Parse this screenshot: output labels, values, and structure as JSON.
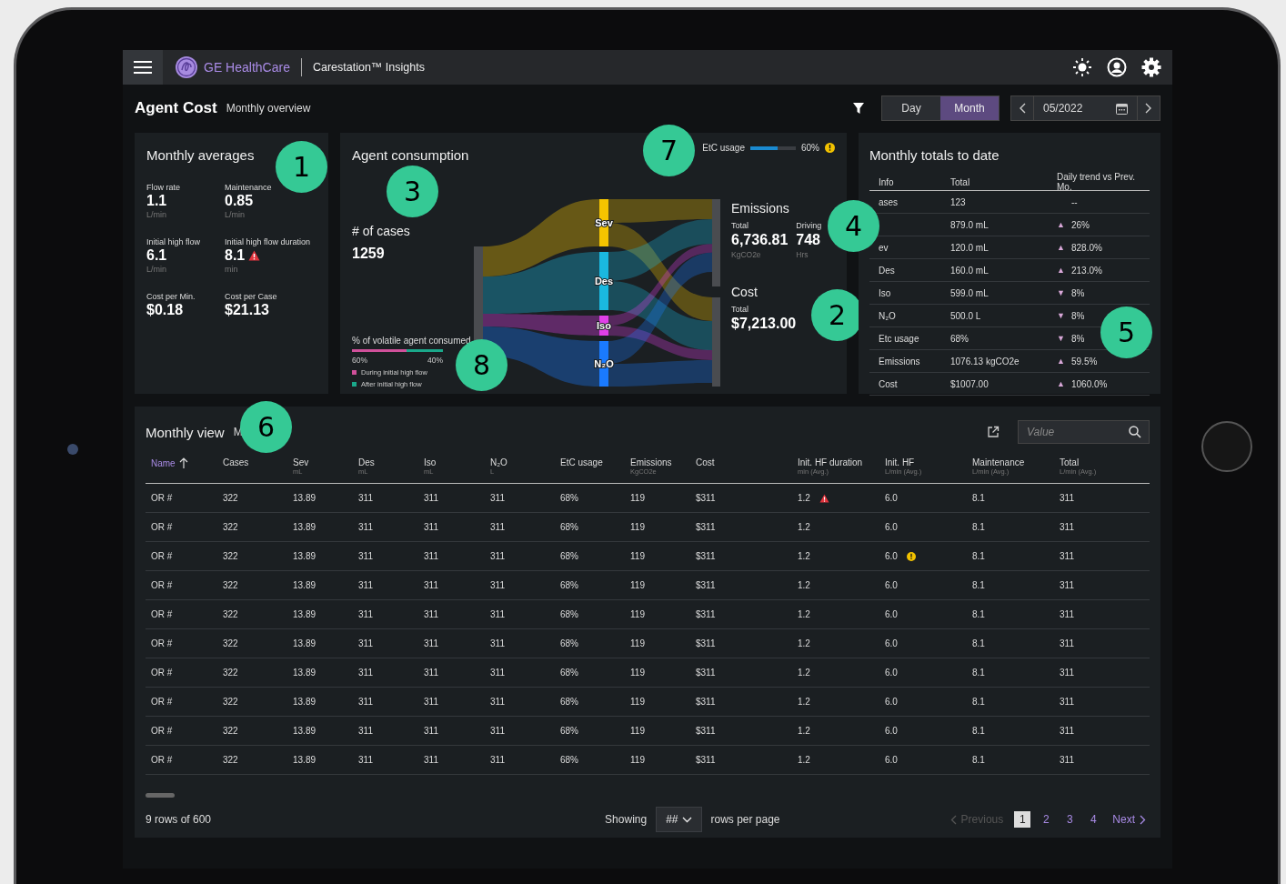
{
  "app": {
    "brand": "GE HealthCare",
    "product": "Carestation™ Insights"
  },
  "page": {
    "title": "Agent Cost",
    "subtitle": "Monthly overview"
  },
  "period": {
    "options": [
      {
        "label": "Day",
        "selected": false
      },
      {
        "label": "Month",
        "selected": true
      }
    ],
    "date": "05/2022"
  },
  "monthly_averages": {
    "title": "Monthly averages",
    "callout": "1",
    "stats": [
      {
        "label": "Flow rate",
        "value": "1.1",
        "unit": "L/min"
      },
      {
        "label": "Maintenance",
        "value": "0.85",
        "unit": "L/min"
      },
      {
        "label": "Initial high flow",
        "value": "6.1",
        "unit": "L/min"
      },
      {
        "label": "Initial high flow duration",
        "value": "8.1",
        "unit": "min",
        "error": true
      },
      {
        "label": "Cost per Min.",
        "value": "$0.18"
      },
      {
        "label": "Cost per Case",
        "value": "$21.13"
      }
    ]
  },
  "agent_consumption": {
    "title": "Agent consumption",
    "callouts": [
      "3",
      "7",
      "8",
      "2"
    ],
    "etc_usage": {
      "label": "EtC usage",
      "level": 0.6,
      "reading": "60%",
      "warning": true
    },
    "cases": {
      "label": "# of cases",
      "value": "1259"
    },
    "volatile": {
      "label": "% of volatile agent consumed",
      "level": 0.6,
      "left_reading": "60%",
      "right_reading": "40%",
      "legend": [
        {
          "label": "During initial high flow",
          "color": "#d0509a"
        },
        {
          "label": "After initial high flow",
          "color": "#1aa88a"
        }
      ]
    },
    "sankey_nodes": [
      {
        "label": "Sev",
        "color": "#f5c400"
      },
      {
        "label": "Des",
        "color": "#1ab8e0"
      },
      {
        "label": "Iso",
        "color": "#e040e8"
      },
      {
        "label": "N₂O",
        "color": "#1a7aff"
      }
    ],
    "emissions": {
      "title": "Emissions",
      "stats": [
        {
          "label": "Total",
          "value": "6,736.81",
          "unit": "KgCO2e"
        },
        {
          "label": "Driving",
          "value": "748",
          "unit": "Hrs"
        }
      ]
    },
    "cost": {
      "title": "Cost",
      "stats": [
        {
          "label": "Total",
          "value": "$7,213.00"
        }
      ]
    }
  },
  "monthly_totals": {
    "title": "Monthly totals to date",
    "callouts": [
      "4",
      "5"
    ],
    "columns": [
      "Info",
      "Total",
      "Daily trend vs Prev. Mo."
    ],
    "rows": [
      {
        "info": "ases",
        "total": "123",
        "change": "--"
      },
      {
        "total": "879.0 mL",
        "trend_icon": "▲",
        "change": "26%"
      },
      {
        "info": "ev",
        "total": "120.0 mL",
        "trend_icon": "▲",
        "change": "828.0%"
      },
      {
        "info": "Des",
        "total": "160.0 mL",
        "trend_icon": "▲",
        "change": "213.0%"
      },
      {
        "info": "Iso",
        "total": "599.0 mL",
        "trend_icon": "▼",
        "change": "8%"
      },
      {
        "info": "N₂O",
        "total": "500.0 L",
        "trend_icon": "▼",
        "change": "8%"
      },
      {
        "info": "Etc usage",
        "total": "68%",
        "trend_icon": "▼",
        "change": "8%"
      },
      {
        "info": "Emissions",
        "total": "1076.13 kgCO2e",
        "trend_icon": "▲",
        "change": "59.5%"
      },
      {
        "info": "Cost",
        "total": "$1007.00",
        "trend_icon": "▲",
        "change": "1060.0%"
      }
    ]
  },
  "monthly_view": {
    "title": "Monthly view",
    "subtitle": "M",
    "callout": "6",
    "search": {
      "placeholder": "Value"
    },
    "columns": [
      {
        "label": "Name",
        "sorted": true
      },
      {
        "label": "Cases",
        "sorted": false
      },
      {
        "label": "Sev",
        "unit": "mL",
        "sorted": false
      },
      {
        "label": "Des",
        "unit": "mL",
        "sorted": false
      },
      {
        "label": "Iso",
        "unit": "mL",
        "sorted": false
      },
      {
        "label": "N₂O",
        "unit": "L",
        "sorted": false
      },
      {
        "label": "EtC usage",
        "sorted": false
      },
      {
        "label": "Emissions",
        "unit": "KgCO2e",
        "sorted": false
      },
      {
        "label": "Cost",
        "sorted": false
      },
      {
        "label": "Init. HF duration",
        "unit": "min (Avg.)",
        "sorted": false
      },
      {
        "label": "Init. HF",
        "unit": "L/min (Avg.)",
        "sorted": false
      },
      {
        "label": "Maintenance",
        "unit": "L/min (Avg.)",
        "sorted": false
      },
      {
        "label": "Total",
        "unit": "L/min (Avg.)",
        "sorted": false
      }
    ],
    "rows": [
      {
        "cells": [
          "OR #",
          "322",
          "13.89",
          "311",
          "311",
          "311",
          "68%",
          "119",
          "$311",
          {
            "text": "1.2",
            "error": true
          },
          "6.0",
          "8.1",
          "311"
        ]
      },
      {
        "cells": [
          "OR #",
          "322",
          "13.89",
          "311",
          "311",
          "311",
          "68%",
          "119",
          "$311",
          "1.2",
          "6.0",
          "8.1",
          "311"
        ]
      },
      {
        "cells": [
          "OR #",
          "322",
          "13.89",
          "311",
          "311",
          "311",
          "68%",
          "119",
          "$311",
          "1.2",
          {
            "text": "6.0",
            "warning": true
          },
          "8.1",
          "311"
        ]
      },
      {
        "cells": [
          "OR #",
          "322",
          "13.89",
          "311",
          "311",
          "311",
          "68%",
          "119",
          "$311",
          "1.2",
          "6.0",
          "8.1",
          "311"
        ]
      },
      {
        "cells": [
          "OR #",
          "322",
          "13.89",
          "311",
          "311",
          "311",
          "68%",
          "119",
          "$311",
          "1.2",
          "6.0",
          "8.1",
          "311"
        ]
      },
      {
        "cells": [
          "OR #",
          "322",
          "13.89",
          "311",
          "311",
          "311",
          "68%",
          "119",
          "$311",
          "1.2",
          "6.0",
          "8.1",
          "311"
        ]
      },
      {
        "cells": [
          "OR #",
          "322",
          "13.89",
          "311",
          "311",
          "311",
          "68%",
          "119",
          "$311",
          "1.2",
          "6.0",
          "8.1",
          "311"
        ]
      },
      {
        "cells": [
          "OR #",
          "322",
          "13.89",
          "311",
          "311",
          "311",
          "68%",
          "119",
          "$311",
          "1.2",
          "6.0",
          "8.1",
          "311"
        ]
      },
      {
        "cells": [
          "OR #",
          "322",
          "13.89",
          "311",
          "311",
          "311",
          "68%",
          "119",
          "$311",
          "1.2",
          "6.0",
          "8.1",
          "311"
        ]
      },
      {
        "cells": [
          "OR #",
          "322",
          "13.89",
          "311",
          "311",
          "311",
          "68%",
          "119",
          "$311",
          "1.2",
          "6.0",
          "8.1",
          "311"
        ]
      }
    ],
    "footer": {
      "count": "9 rows of 600",
      "showing": "Showing",
      "page_size": "##",
      "per_page": "rows per page"
    },
    "pagination": {
      "previous": {
        "label": "Previous",
        "disabled": true
      },
      "pages": [
        {
          "label": "1",
          "selected": true
        },
        {
          "label": "2",
          "selected": false
        },
        {
          "label": "3",
          "selected": false
        },
        {
          "label": "4",
          "selected": false
        }
      ],
      "next": {
        "label": "Next",
        "disabled": false
      }
    }
  }
}
